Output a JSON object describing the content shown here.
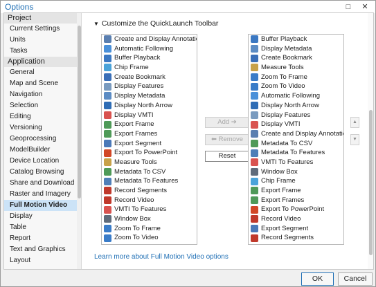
{
  "window": {
    "title": "Options",
    "minimize_glyph": "□",
    "close_glyph": "✕"
  },
  "sidebar": {
    "sections": [
      {
        "heading": "Project",
        "items": [
          "Current Settings",
          "Units",
          "Tasks"
        ]
      },
      {
        "heading": "Application",
        "items": [
          "General",
          "Map and Scene",
          "Navigation",
          "Selection",
          "Editing",
          "Versioning",
          "Geoprocessing",
          "ModelBuilder",
          "Device Location",
          "Catalog Browsing",
          "Share and Download",
          "Raster and Imagery",
          "Full Motion Video",
          "Display",
          "Table",
          "Report",
          "Text and Graphics",
          "Layout"
        ]
      }
    ],
    "selected": "Full Motion Video"
  },
  "main": {
    "section_title": "Customize the QuickLaunch Toolbar",
    "left_list": [
      {
        "label": "Create and Display Annotations",
        "icon": "annotation-icon",
        "color": "#5a7fb0"
      },
      {
        "label": "Automatic Following",
        "icon": "follow-icon",
        "color": "#4a90d9"
      },
      {
        "label": "Buffer Playback",
        "icon": "buffer-icon",
        "color": "#3b78c2"
      },
      {
        "label": "Chip Frame",
        "icon": "chip-frame-icon",
        "color": "#4aa3d9"
      },
      {
        "label": "Create Bookmark",
        "icon": "bookmark-icon",
        "color": "#3a6fb8"
      },
      {
        "label": "Display Features",
        "icon": "features-icon",
        "color": "#7a9bbf"
      },
      {
        "label": "Display Metadata",
        "icon": "metadata-icon",
        "color": "#5c8cc4"
      },
      {
        "label": "Display North Arrow",
        "icon": "north-arrow-icon",
        "color": "#2f6db5"
      },
      {
        "label": "Display VMTI",
        "icon": "vmti-icon",
        "color": "#d9534f"
      },
      {
        "label": "Export Frame",
        "icon": "export-frame-icon",
        "color": "#4f9a58"
      },
      {
        "label": "Export Frames",
        "icon": "export-frames-icon",
        "color": "#4f9a58"
      },
      {
        "label": "Export Segment",
        "icon": "export-segment-icon",
        "color": "#4a79b8"
      },
      {
        "label": "Export To PowerPoint",
        "icon": "powerpoint-icon",
        "color": "#d24726"
      },
      {
        "label": "Measure Tools",
        "icon": "measure-icon",
        "color": "#c8a24a"
      },
      {
        "label": "Metadata To CSV",
        "icon": "csv-icon",
        "color": "#4f9a58"
      },
      {
        "label": "Metadata To Features",
        "icon": "meta-features-icon",
        "color": "#4f7fb8"
      },
      {
        "label": "Record Segments",
        "icon": "record-segments-icon",
        "color": "#c0392b"
      },
      {
        "label": "Record Video",
        "icon": "record-video-icon",
        "color": "#c0392b"
      },
      {
        "label": "VMTI To Features",
        "icon": "vmti-features-icon",
        "color": "#d9534f"
      },
      {
        "label": "Window Box",
        "icon": "window-box-icon",
        "color": "#5f6b7a"
      },
      {
        "label": "Zoom To Frame",
        "icon": "zoom-frame-icon",
        "color": "#3a7cc8"
      },
      {
        "label": "Zoom To Video",
        "icon": "zoom-video-icon",
        "color": "#3a7cc8"
      }
    ],
    "right_list": [
      {
        "label": "Buffer Playback",
        "icon": "buffer-icon",
        "color": "#3b78c2"
      },
      {
        "label": "Display Metadata",
        "icon": "metadata-icon",
        "color": "#5c8cc4"
      },
      {
        "label": "Create Bookmark",
        "icon": "bookmark-icon",
        "color": "#3a6fb8"
      },
      {
        "label": "Measure Tools",
        "icon": "measure-icon",
        "color": "#c8a24a"
      },
      {
        "label": "Zoom To Frame",
        "icon": "zoom-frame-icon",
        "color": "#3a7cc8"
      },
      {
        "label": "Zoom To Video",
        "icon": "zoom-video-icon",
        "color": "#3a7cc8"
      },
      {
        "label": "Automatic Following",
        "icon": "follow-icon",
        "color": "#4a90d9"
      },
      {
        "label": "Display North Arrow",
        "icon": "north-arrow-icon",
        "color": "#2f6db5"
      },
      {
        "label": "Display Features",
        "icon": "features-icon",
        "color": "#7a9bbf"
      },
      {
        "label": "Display VMTI",
        "icon": "vmti-icon",
        "color": "#d9534f"
      },
      {
        "label": "Create and Display Annotations",
        "icon": "annotation-icon",
        "color": "#5a7fb0"
      },
      {
        "label": "Metadata To CSV",
        "icon": "csv-icon",
        "color": "#4f9a58"
      },
      {
        "label": "Metadata To Features",
        "icon": "meta-features-icon",
        "color": "#4f7fb8"
      },
      {
        "label": "VMTI To Features",
        "icon": "vmti-features-icon",
        "color": "#d9534f"
      },
      {
        "label": "Window Box",
        "icon": "window-box-icon",
        "color": "#5f6b7a"
      },
      {
        "label": "Chip Frame",
        "icon": "chip-frame-icon",
        "color": "#4aa3d9"
      },
      {
        "label": "Export Frame",
        "icon": "export-frame-icon",
        "color": "#4f9a58"
      },
      {
        "label": "Export Frames",
        "icon": "export-frames-icon",
        "color": "#4f9a58"
      },
      {
        "label": "Export To PowerPoint",
        "icon": "powerpoint-icon",
        "color": "#d24726"
      },
      {
        "label": "Record Video",
        "icon": "record-video-icon",
        "color": "#c0392b"
      },
      {
        "label": "Export Segment",
        "icon": "export-segment-icon",
        "color": "#4a79b8"
      },
      {
        "label": "Record Segments",
        "icon": "record-segments-icon",
        "color": "#c0392b"
      }
    ],
    "add_label": "Add ➔",
    "remove_label": "⬅ Remove",
    "reset_label": "Reset",
    "move_up_glyph": "▲",
    "move_down_glyph": "▼",
    "link_text": "Learn more about Full Motion Video options"
  },
  "footer": {
    "ok_label": "OK",
    "cancel_label": "Cancel"
  },
  "colors": {
    "accent": "#1f6fb5",
    "selected_bg": "#cce3f7"
  }
}
